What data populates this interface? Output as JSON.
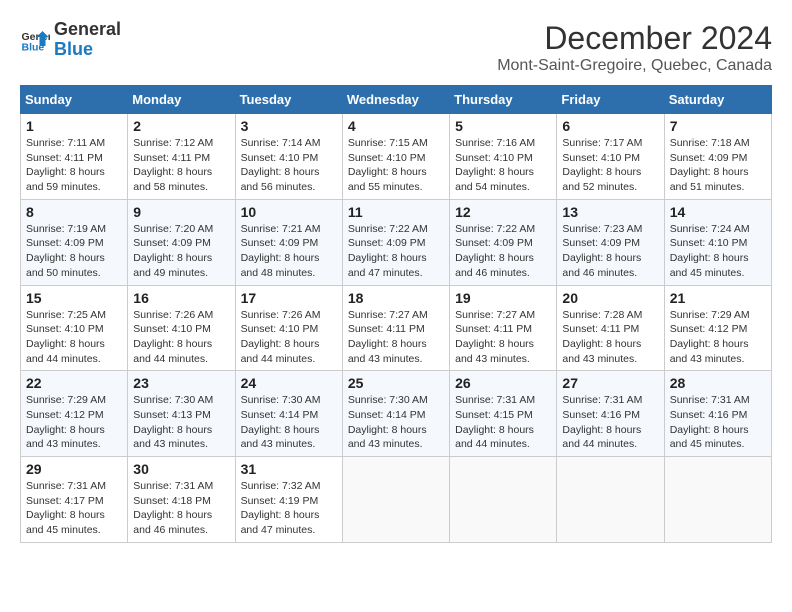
{
  "header": {
    "logo_line1": "General",
    "logo_line2": "Blue",
    "title": "December 2024",
    "subtitle": "Mont-Saint-Gregoire, Quebec, Canada"
  },
  "days_of_week": [
    "Sunday",
    "Monday",
    "Tuesday",
    "Wednesday",
    "Thursday",
    "Friday",
    "Saturday"
  ],
  "weeks": [
    [
      {
        "day": "1",
        "sunrise": "7:11 AM",
        "sunset": "4:11 PM",
        "daylight": "8 hours and 59 minutes."
      },
      {
        "day": "2",
        "sunrise": "7:12 AM",
        "sunset": "4:11 PM",
        "daylight": "8 hours and 58 minutes."
      },
      {
        "day": "3",
        "sunrise": "7:14 AM",
        "sunset": "4:10 PM",
        "daylight": "8 hours and 56 minutes."
      },
      {
        "day": "4",
        "sunrise": "7:15 AM",
        "sunset": "4:10 PM",
        "daylight": "8 hours and 55 minutes."
      },
      {
        "day": "5",
        "sunrise": "7:16 AM",
        "sunset": "4:10 PM",
        "daylight": "8 hours and 54 minutes."
      },
      {
        "day": "6",
        "sunrise": "7:17 AM",
        "sunset": "4:10 PM",
        "daylight": "8 hours and 52 minutes."
      },
      {
        "day": "7",
        "sunrise": "7:18 AM",
        "sunset": "4:09 PM",
        "daylight": "8 hours and 51 minutes."
      }
    ],
    [
      {
        "day": "8",
        "sunrise": "7:19 AM",
        "sunset": "4:09 PM",
        "daylight": "8 hours and 50 minutes."
      },
      {
        "day": "9",
        "sunrise": "7:20 AM",
        "sunset": "4:09 PM",
        "daylight": "8 hours and 49 minutes."
      },
      {
        "day": "10",
        "sunrise": "7:21 AM",
        "sunset": "4:09 PM",
        "daylight": "8 hours and 48 minutes."
      },
      {
        "day": "11",
        "sunrise": "7:22 AM",
        "sunset": "4:09 PM",
        "daylight": "8 hours and 47 minutes."
      },
      {
        "day": "12",
        "sunrise": "7:22 AM",
        "sunset": "4:09 PM",
        "daylight": "8 hours and 46 minutes."
      },
      {
        "day": "13",
        "sunrise": "7:23 AM",
        "sunset": "4:09 PM",
        "daylight": "8 hours and 46 minutes."
      },
      {
        "day": "14",
        "sunrise": "7:24 AM",
        "sunset": "4:10 PM",
        "daylight": "8 hours and 45 minutes."
      }
    ],
    [
      {
        "day": "15",
        "sunrise": "7:25 AM",
        "sunset": "4:10 PM",
        "daylight": "8 hours and 44 minutes."
      },
      {
        "day": "16",
        "sunrise": "7:26 AM",
        "sunset": "4:10 PM",
        "daylight": "8 hours and 44 minutes."
      },
      {
        "day": "17",
        "sunrise": "7:26 AM",
        "sunset": "4:10 PM",
        "daylight": "8 hours and 44 minutes."
      },
      {
        "day": "18",
        "sunrise": "7:27 AM",
        "sunset": "4:11 PM",
        "daylight": "8 hours and 43 minutes."
      },
      {
        "day": "19",
        "sunrise": "7:27 AM",
        "sunset": "4:11 PM",
        "daylight": "8 hours and 43 minutes."
      },
      {
        "day": "20",
        "sunrise": "7:28 AM",
        "sunset": "4:11 PM",
        "daylight": "8 hours and 43 minutes."
      },
      {
        "day": "21",
        "sunrise": "7:29 AM",
        "sunset": "4:12 PM",
        "daylight": "8 hours and 43 minutes."
      }
    ],
    [
      {
        "day": "22",
        "sunrise": "7:29 AM",
        "sunset": "4:12 PM",
        "daylight": "8 hours and 43 minutes."
      },
      {
        "day": "23",
        "sunrise": "7:30 AM",
        "sunset": "4:13 PM",
        "daylight": "8 hours and 43 minutes."
      },
      {
        "day": "24",
        "sunrise": "7:30 AM",
        "sunset": "4:14 PM",
        "daylight": "8 hours and 43 minutes."
      },
      {
        "day": "25",
        "sunrise": "7:30 AM",
        "sunset": "4:14 PM",
        "daylight": "8 hours and 43 minutes."
      },
      {
        "day": "26",
        "sunrise": "7:31 AM",
        "sunset": "4:15 PM",
        "daylight": "8 hours and 44 minutes."
      },
      {
        "day": "27",
        "sunrise": "7:31 AM",
        "sunset": "4:16 PM",
        "daylight": "8 hours and 44 minutes."
      },
      {
        "day": "28",
        "sunrise": "7:31 AM",
        "sunset": "4:16 PM",
        "daylight": "8 hours and 45 minutes."
      }
    ],
    [
      {
        "day": "29",
        "sunrise": "7:31 AM",
        "sunset": "4:17 PM",
        "daylight": "8 hours and 45 minutes."
      },
      {
        "day": "30",
        "sunrise": "7:31 AM",
        "sunset": "4:18 PM",
        "daylight": "8 hours and 46 minutes."
      },
      {
        "day": "31",
        "sunrise": "7:32 AM",
        "sunset": "4:19 PM",
        "daylight": "8 hours and 47 minutes."
      },
      null,
      null,
      null,
      null
    ]
  ]
}
